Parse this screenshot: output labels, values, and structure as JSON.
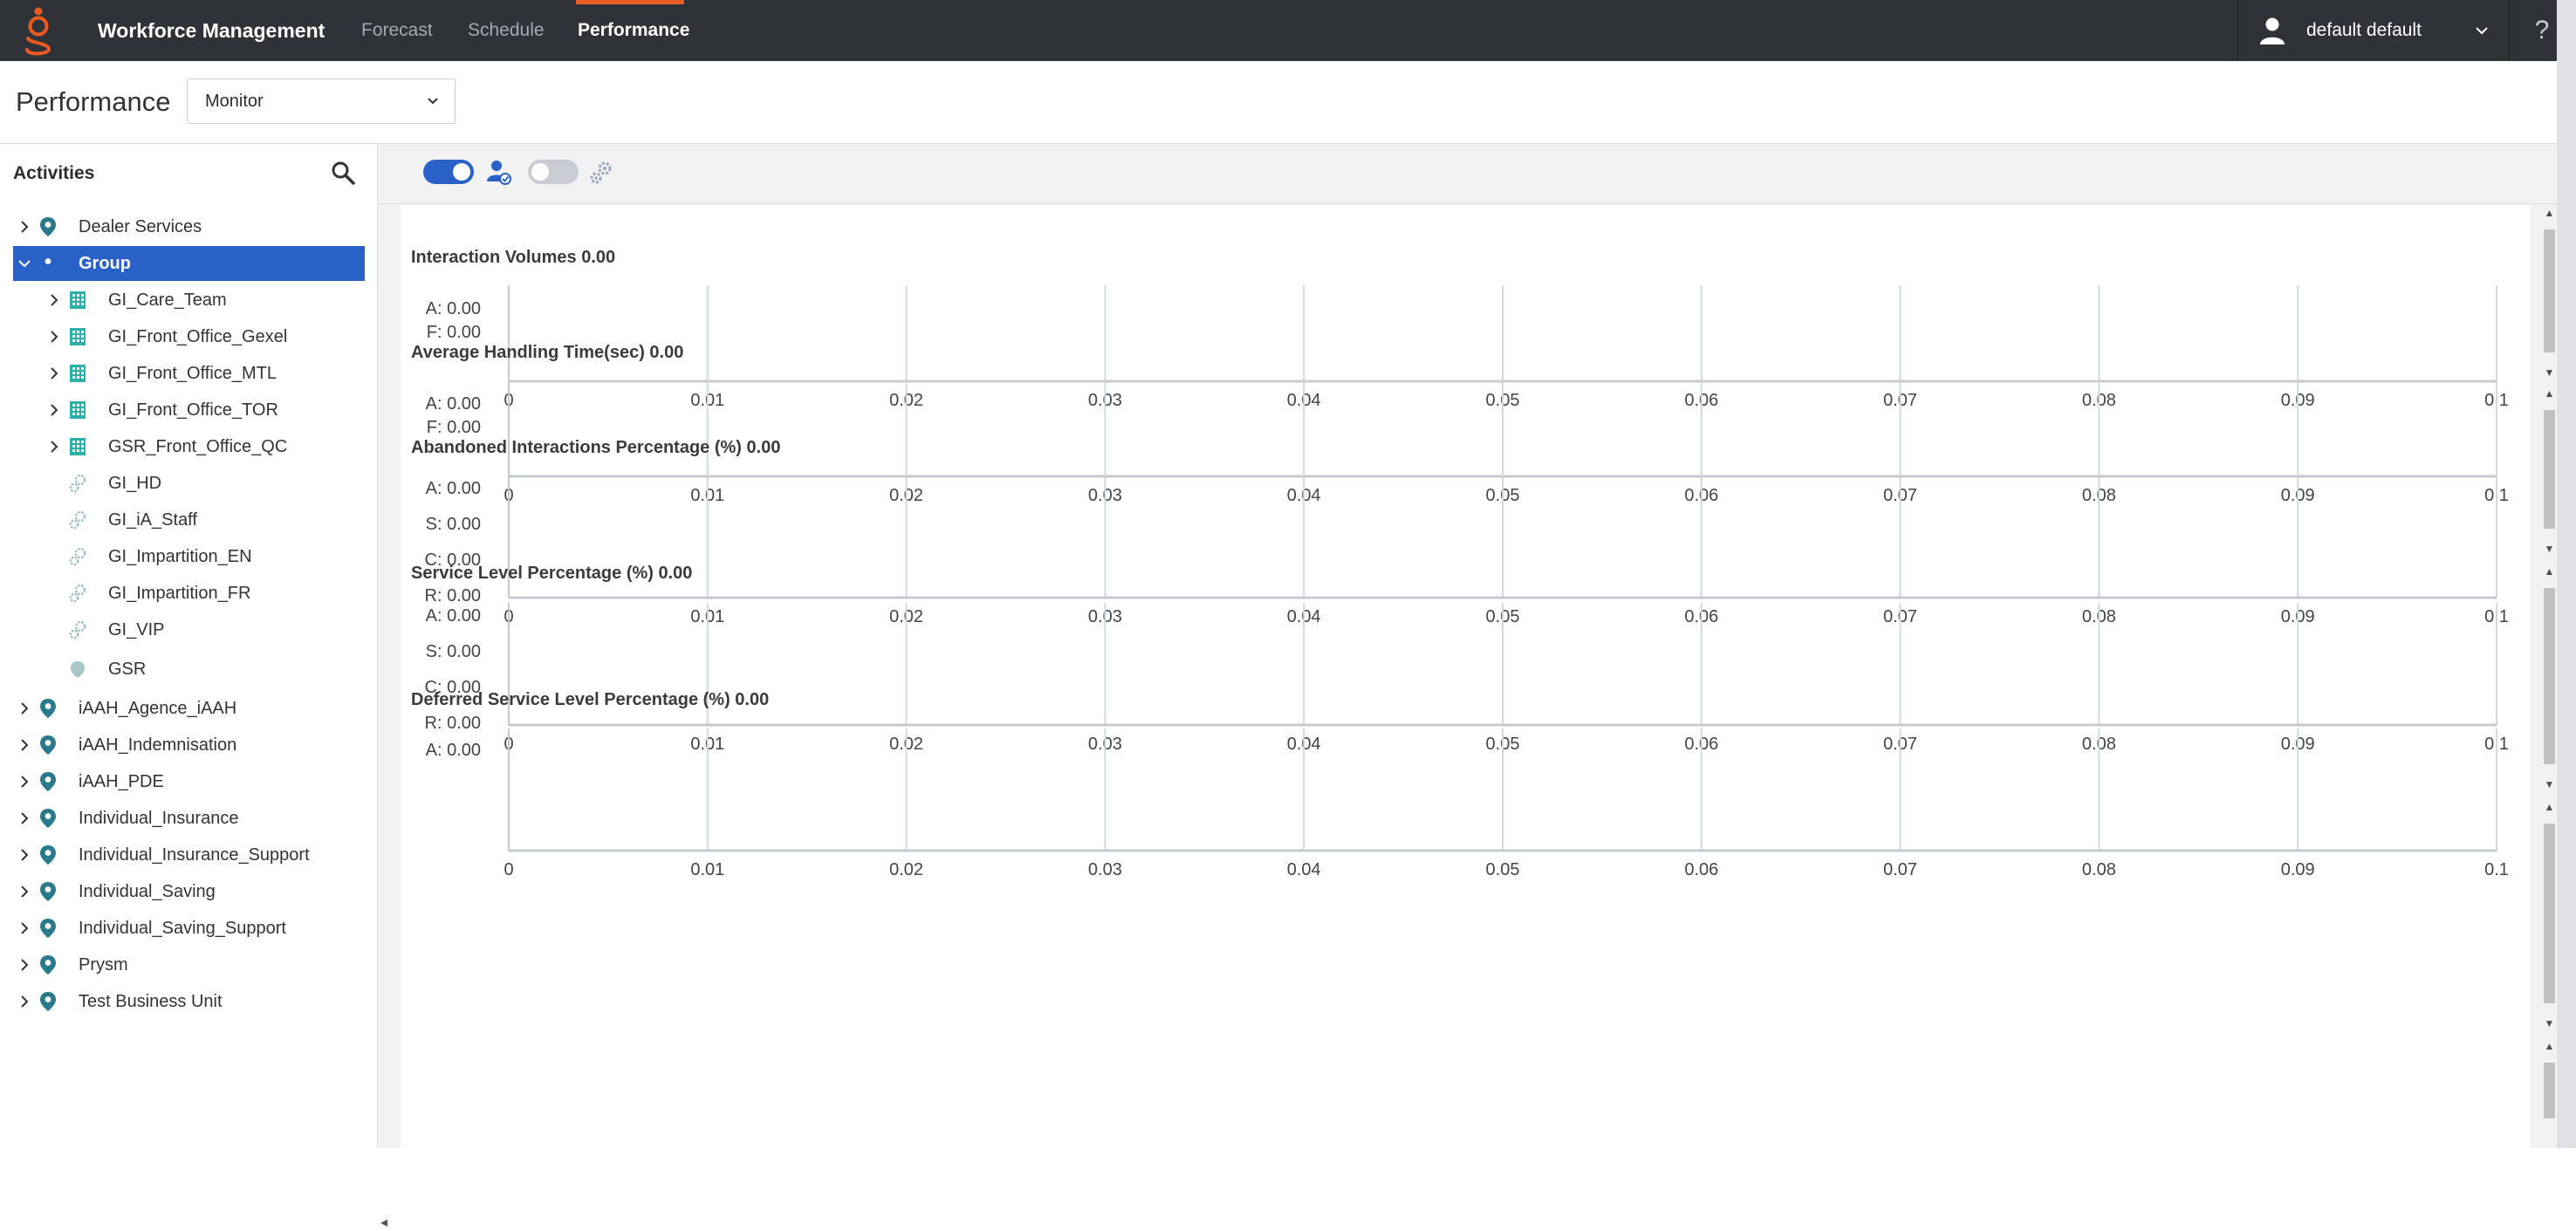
{
  "app": {
    "title": "Workforce Management",
    "nav": [
      "Forecast",
      "Schedule",
      "Performance"
    ],
    "active_tab": "Performance",
    "user": "default default",
    "help": "?",
    "accent": "#ea5b24",
    "selection_color": "#2a61c8"
  },
  "page": {
    "title": "Performance",
    "view_select": "Monitor"
  },
  "sidebar": {
    "title": "Activities",
    "items": [
      {
        "label": "Dealer Services",
        "level": 0,
        "icon": "map-pin-icon",
        "expandable": true,
        "expanded": false
      },
      {
        "label": "Group",
        "level": 0,
        "icon": "map-pin-icon",
        "expandable": true,
        "expanded": true,
        "selected": true
      },
      {
        "label": "GI_Care_Team",
        "level": 1,
        "icon": "building-icon",
        "expandable": true,
        "expanded": false
      },
      {
        "label": "GI_Front_Office_Gexel",
        "level": 1,
        "icon": "building-icon",
        "expandable": true,
        "expanded": false
      },
      {
        "label": "GI_Front_Office_MTL",
        "level": 1,
        "icon": "building-icon",
        "expandable": true,
        "expanded": false
      },
      {
        "label": "GI_Front_Office_TOR",
        "level": 1,
        "icon": "building-icon",
        "expandable": true,
        "expanded": false
      },
      {
        "label": "GSR_Front_Office_QC",
        "level": 1,
        "icon": "building-icon",
        "expandable": true,
        "expanded": false
      },
      {
        "label": "GI_HD",
        "level": 1,
        "icon": "gears-icon",
        "expandable": false
      },
      {
        "label": "GI_iA_Staff",
        "level": 1,
        "icon": "gears-icon",
        "expandable": false
      },
      {
        "label": "GI_Impartition_EN",
        "level": 1,
        "icon": "gears-icon",
        "expandable": false
      },
      {
        "label": "GI_Impartition_FR",
        "level": 1,
        "icon": "gears-icon",
        "expandable": false
      },
      {
        "label": "GI_VIP",
        "level": 1,
        "icon": "gears-icon",
        "expandable": false
      },
      {
        "label": "GSR",
        "level": 1,
        "icon": "shield-icon",
        "expandable": false
      },
      {
        "label": "iAAH_Agence_iAAH",
        "level": 0,
        "icon": "map-pin-icon",
        "expandable": true,
        "expanded": false
      },
      {
        "label": "iAAH_Indemnisation",
        "level": 0,
        "icon": "map-pin-icon",
        "expandable": true,
        "expanded": false
      },
      {
        "label": "iAAH_PDE",
        "level": 0,
        "icon": "map-pin-icon",
        "expandable": true,
        "expanded": false
      },
      {
        "label": "Individual_Insurance",
        "level": 0,
        "icon": "map-pin-icon",
        "expandable": true,
        "expanded": false
      },
      {
        "label": "Individual_Insurance_Support",
        "level": 0,
        "icon": "map-pin-icon",
        "expandable": true,
        "expanded": false
      },
      {
        "label": "Individual_Saving",
        "level": 0,
        "icon": "map-pin-icon",
        "expandable": true,
        "expanded": false
      },
      {
        "label": "Individual_Saving_Support",
        "level": 0,
        "icon": "map-pin-icon",
        "expandable": true,
        "expanded": false
      },
      {
        "label": "Prysm",
        "level": 0,
        "icon": "map-pin-icon",
        "expandable": true,
        "expanded": false
      },
      {
        "label": "Test Business Unit",
        "level": 0,
        "icon": "map-pin-icon",
        "expandable": true,
        "expanded": false
      }
    ]
  },
  "toolbar": {
    "toggle_1": "on",
    "icon_1": "user-check-icon",
    "toggle_2": "off",
    "icon_2": "gears-icon"
  },
  "chart_data": [
    {
      "type": "bar",
      "title": "Interaction Volumes 0.00",
      "xlim": [
        0,
        0.1
      ],
      "x_ticks": [
        "0",
        "0.01",
        "0.02",
        "0.03",
        "0.04",
        "0.05",
        "0.06",
        "0.07",
        "0.08",
        "0.09",
        "0.1"
      ],
      "categories": [
        "A: 0.00",
        "F: 0.00"
      ],
      "values": [
        0,
        0
      ],
      "grid": true
    },
    {
      "type": "bar",
      "title": "Average Handling Time(sec) 0.00",
      "xlim": [
        0,
        0.1
      ],
      "x_ticks": [
        "0",
        "0.01",
        "0.02",
        "0.03",
        "0.04",
        "0.05",
        "0.06",
        "0.07",
        "0.08",
        "0.09",
        "0.1"
      ],
      "categories": [
        "A: 0.00",
        "F: 0.00"
      ],
      "values": [
        0,
        0
      ],
      "grid": true
    },
    {
      "type": "bar",
      "title": "Abandoned Interactions Percentage (%) 0.00",
      "xlim": [
        0,
        0.1
      ],
      "x_ticks": [
        "0",
        "0.01",
        "0.02",
        "0.03",
        "0.04",
        "0.05",
        "0.06",
        "0.07",
        "0.08",
        "0.09",
        "0.1"
      ],
      "categories": [
        "A: 0.00",
        "S: 0.00",
        "C: 0.00",
        "R: 0.00"
      ],
      "values": [
        0,
        0,
        0,
        0
      ],
      "grid": true
    },
    {
      "type": "bar",
      "title": "Service Level Percentage (%) 0.00",
      "xlim": [
        0,
        0.1
      ],
      "x_ticks": [
        "0",
        "0.01",
        "0.02",
        "0.03",
        "0.04",
        "0.05",
        "0.06",
        "0.07",
        "0.08",
        "0.09",
        "0.1"
      ],
      "categories": [
        "A: 0.00",
        "S: 0.00",
        "C: 0.00",
        "R: 0.00"
      ],
      "values": [
        0,
        0,
        0,
        0
      ],
      "grid": true
    },
    {
      "type": "bar",
      "title": "Deferred Service Level Percentage (%) 0.00",
      "xlim": [
        0,
        0.1
      ],
      "x_ticks": [
        "0",
        "0.01",
        "0.02",
        "0.03",
        "0.04",
        "0.05",
        "0.06",
        "0.07",
        "0.08",
        "0.09",
        "0.1"
      ],
      "categories": [
        "A: 0.00"
      ],
      "values": [
        0
      ],
      "grid": true
    }
  ]
}
